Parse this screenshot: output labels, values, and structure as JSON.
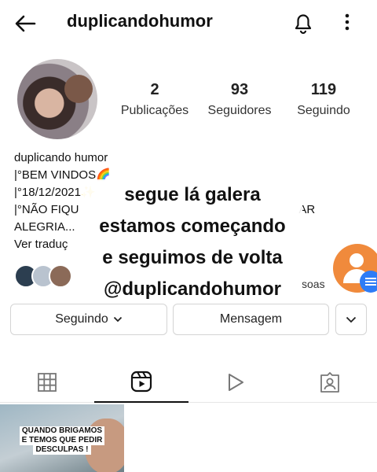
{
  "header": {
    "username": "duplicandohumor"
  },
  "stats": {
    "posts": {
      "value": "2",
      "label": "Publicações"
    },
    "followers": {
      "value": "93",
      "label": "Seguidores"
    },
    "following": {
      "value": "119",
      "label": "Seguindo"
    }
  },
  "bio": {
    "name": "duplicando humor",
    "line1": "|°BEM VINDOS🌈",
    "line2": "|°18/12/2021✨",
    "line3_start": "|°NÃO FIQU",
    "line3_end": "AR",
    "line4": "ALEGRIA...",
    "see_translation": "Ver traduç",
    "people_suffix": "soas"
  },
  "overlay": {
    "line1": "segue lá galera",
    "line2": "estamos começando",
    "line3": "e seguimos de volta",
    "line4": "@duplicandohumor"
  },
  "buttons": {
    "following": "Seguindo",
    "message": "Mensagem"
  },
  "thumbnail": {
    "line1": "QUANDO BRIGAMOS",
    "line2": "E TEMOS QUE PEDIR",
    "line3": "DESCULPAS !"
  },
  "icons": {
    "back": "arrow-left-icon",
    "bell": "bell-icon",
    "more": "more-vertical-icon",
    "grid": "grid-icon",
    "reels": "reels-icon",
    "video": "play-icon",
    "tagged": "tagged-icon"
  },
  "colors": {
    "accent_orange": "#f08a3c",
    "accent_blue": "#2e7cf6",
    "border": "#d4d4d4"
  }
}
